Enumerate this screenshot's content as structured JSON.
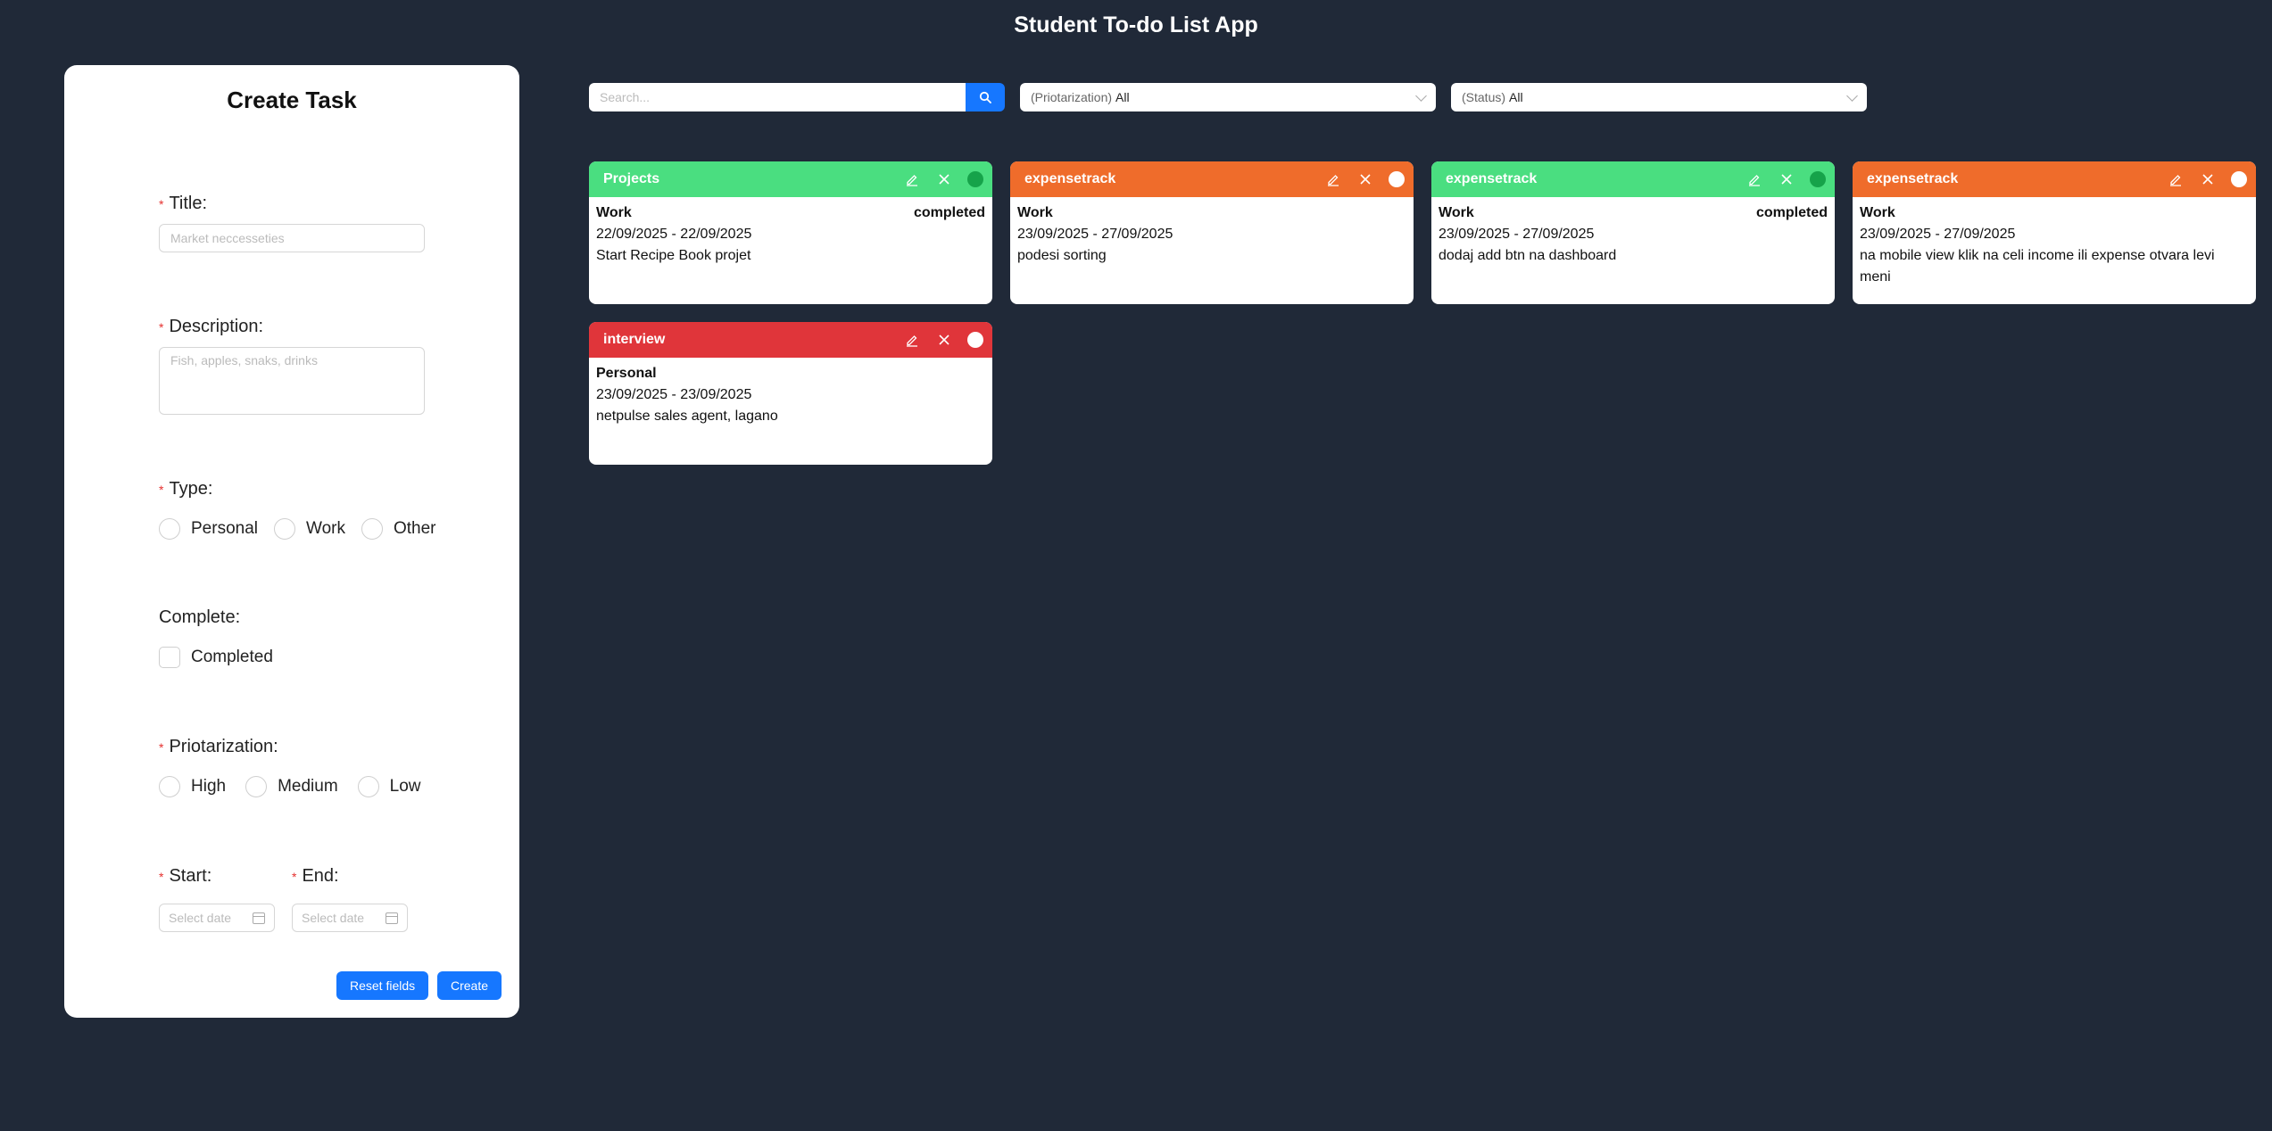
{
  "app": {
    "title": "Student To-do List App"
  },
  "form": {
    "title": "Create Task",
    "title_label": "Title:",
    "title_placeholder": "Market neccesseties",
    "description_label": "Description:",
    "description_placeholder": "Fish, apples, snaks, drinks",
    "type_label": "Type:",
    "type_options": [
      "Personal",
      "Work",
      "Other"
    ],
    "complete_label": "Complete:",
    "completed_option": "Completed",
    "priority_label": "Priotarization:",
    "priority_options": [
      "High",
      "Medium",
      "Low"
    ],
    "start_label": "Start:",
    "end_label": "End:",
    "date_placeholder": "Select date",
    "reset_label": "Reset fields",
    "create_label": "Create"
  },
  "filters": {
    "search_placeholder": "Search...",
    "priority_prefix": "(Priotarization)",
    "priority_value": "All",
    "status_prefix": "(Status)",
    "status_value": "All"
  },
  "colors": {
    "background": "#202938",
    "green": "#4ade80",
    "orange": "#ef6c2b",
    "red": "#e0353a",
    "primary": "#1677ff",
    "done_dot": "#16a34a"
  },
  "tasks": [
    {
      "title": "Projects",
      "type": "Work",
      "status": "completed",
      "dates": "22/09/2025 - 22/09/2025",
      "description": "Start Recipe Book projet",
      "color": "#4ade80",
      "done": true
    },
    {
      "title": "expensetrack",
      "type": "Work",
      "status": "",
      "dates": "23/09/2025 - 27/09/2025",
      "description": "podesi sorting",
      "color": "#ef6c2b",
      "done": false
    },
    {
      "title": "expensetrack",
      "type": "Work",
      "status": "completed",
      "dates": "23/09/2025 - 27/09/2025",
      "description": "dodaj add btn na dashboard",
      "color": "#4ade80",
      "done": true
    },
    {
      "title": "expensetrack",
      "type": "Work",
      "status": "",
      "dates": "23/09/2025 - 27/09/2025",
      "description": "na mobile view klik na celi income ili expense otvara levi meni",
      "color": "#ef6c2b",
      "done": false
    },
    {
      "title": "interview",
      "type": "Personal",
      "status": "",
      "dates": "23/09/2025 - 23/09/2025",
      "description": "netpulse sales agent, lagano",
      "color": "#e0353a",
      "done": false
    }
  ]
}
